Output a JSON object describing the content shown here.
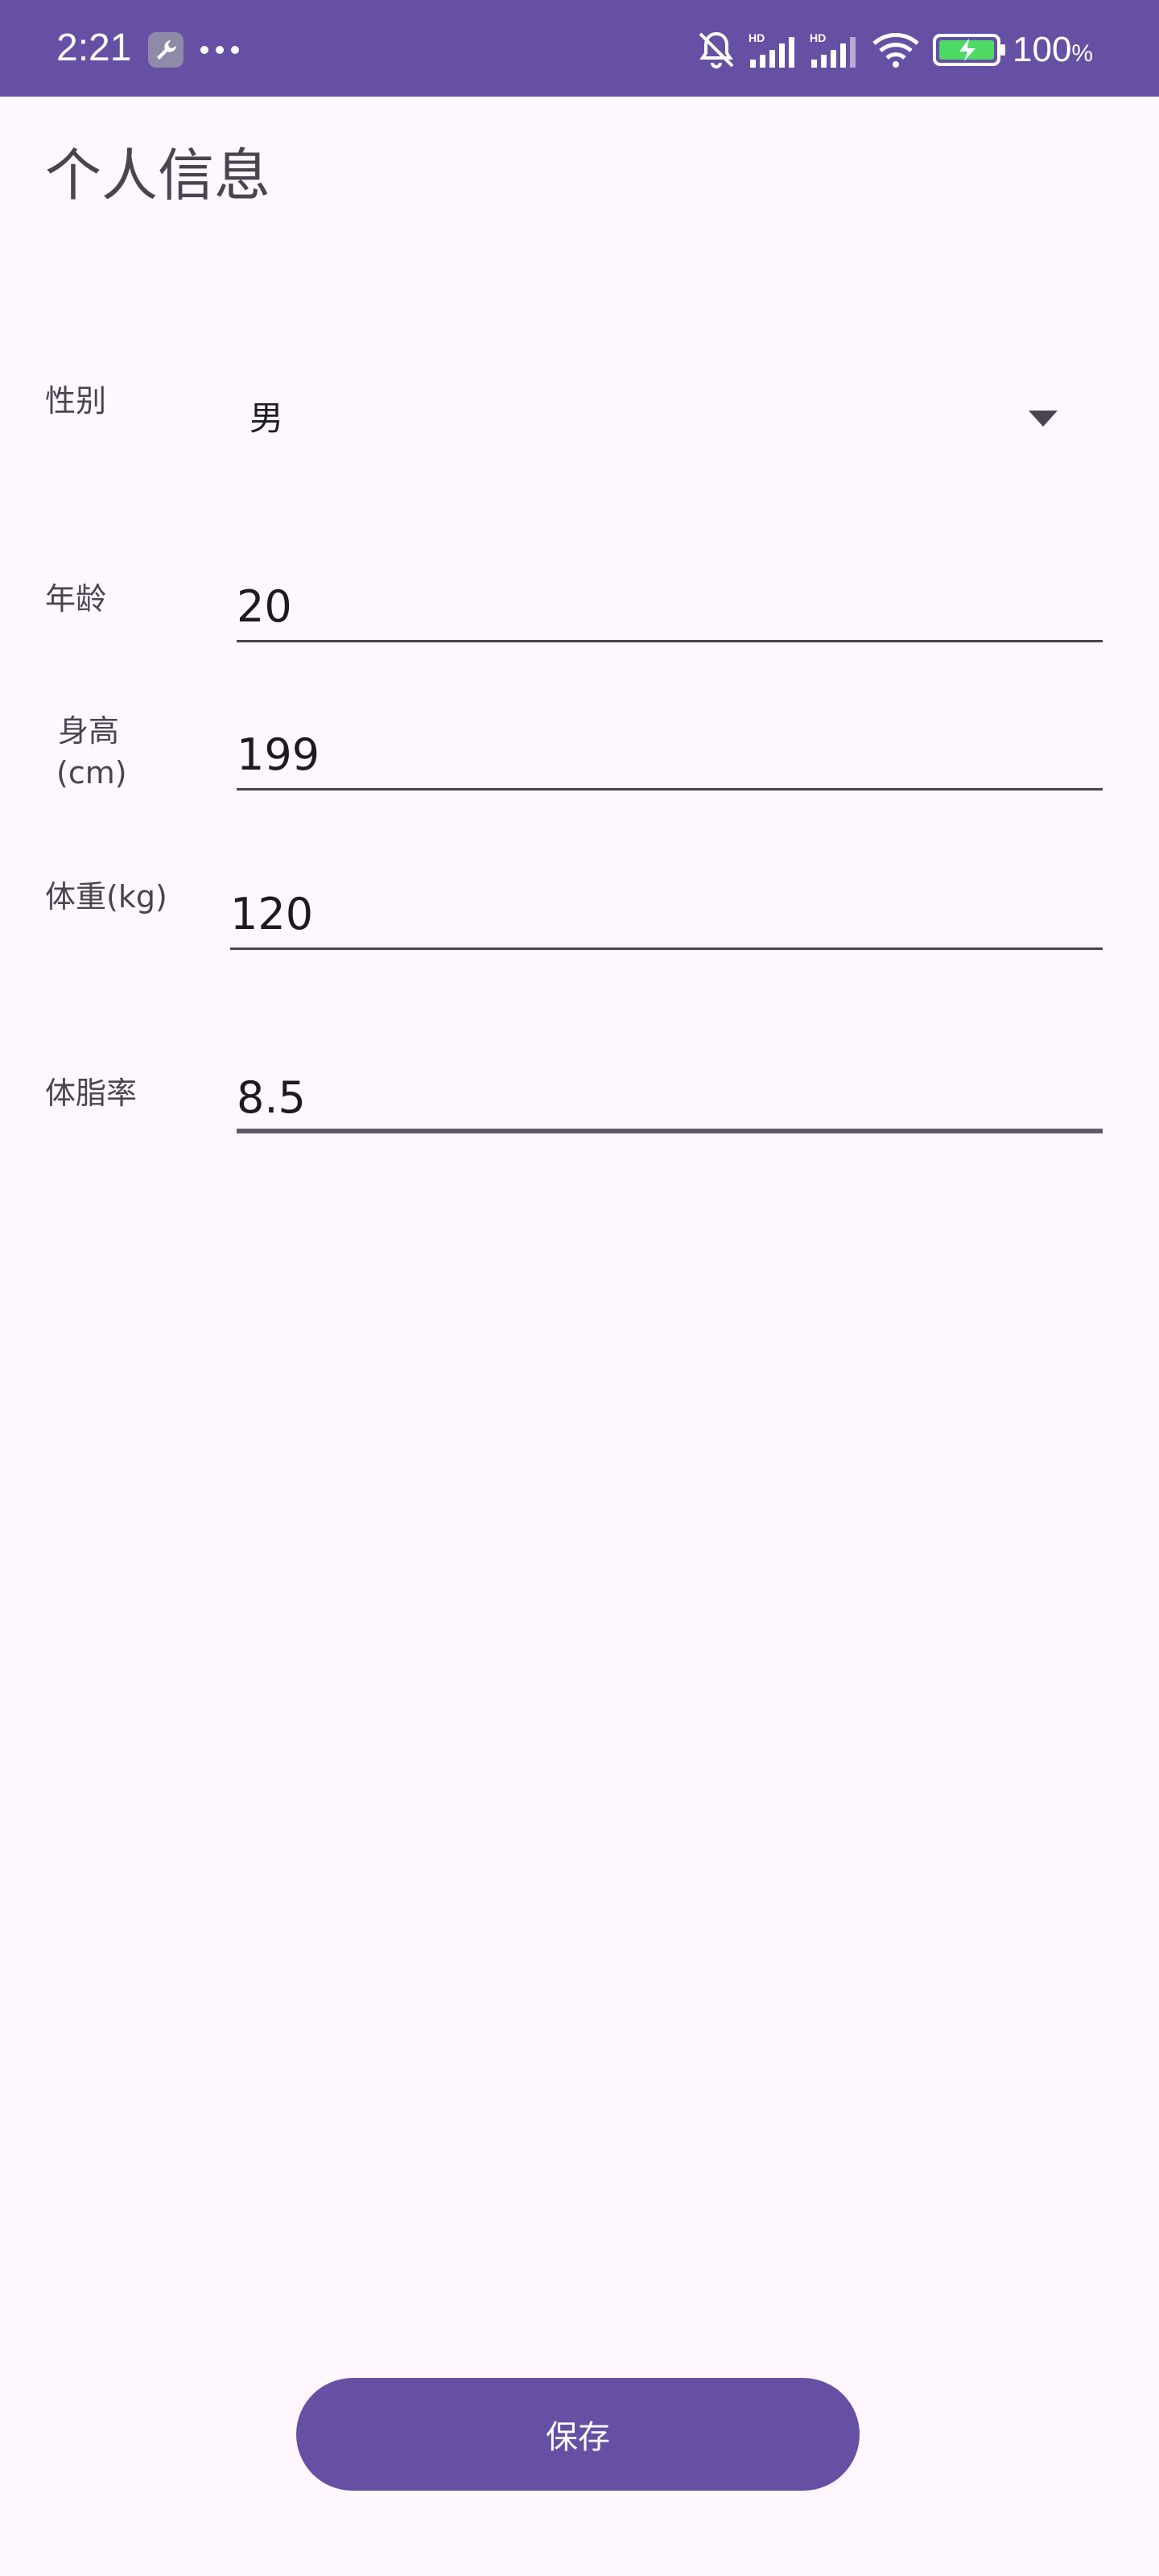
{
  "status_bar": {
    "time": "2:21",
    "battery_value": "100",
    "battery_unit": "%",
    "icons": [
      "wrench-app-icon",
      "more-dots-icon",
      "bell-muted-icon",
      "signal-hd-icon",
      "signal-hd-icon",
      "wifi-icon",
      "battery-charging-icon"
    ],
    "signal_badge_1": "HD",
    "signal_badge_2": "HD",
    "background_color": "#6650A4"
  },
  "page": {
    "title": "个人信息"
  },
  "form": {
    "gender": {
      "label": "性别",
      "selected": "男",
      "icon": "dropdown-arrow-icon"
    },
    "age": {
      "label": "年龄",
      "value": "20"
    },
    "height": {
      "label_line1": "身高",
      "label_line2": "(cm)",
      "value": "199"
    },
    "weight": {
      "label": "体重(kg)",
      "value": "120"
    },
    "body_fat": {
      "label": "体脂率",
      "value": "8.5"
    }
  },
  "actions": {
    "save_label": "保存",
    "accent_color": "#6650A4"
  }
}
